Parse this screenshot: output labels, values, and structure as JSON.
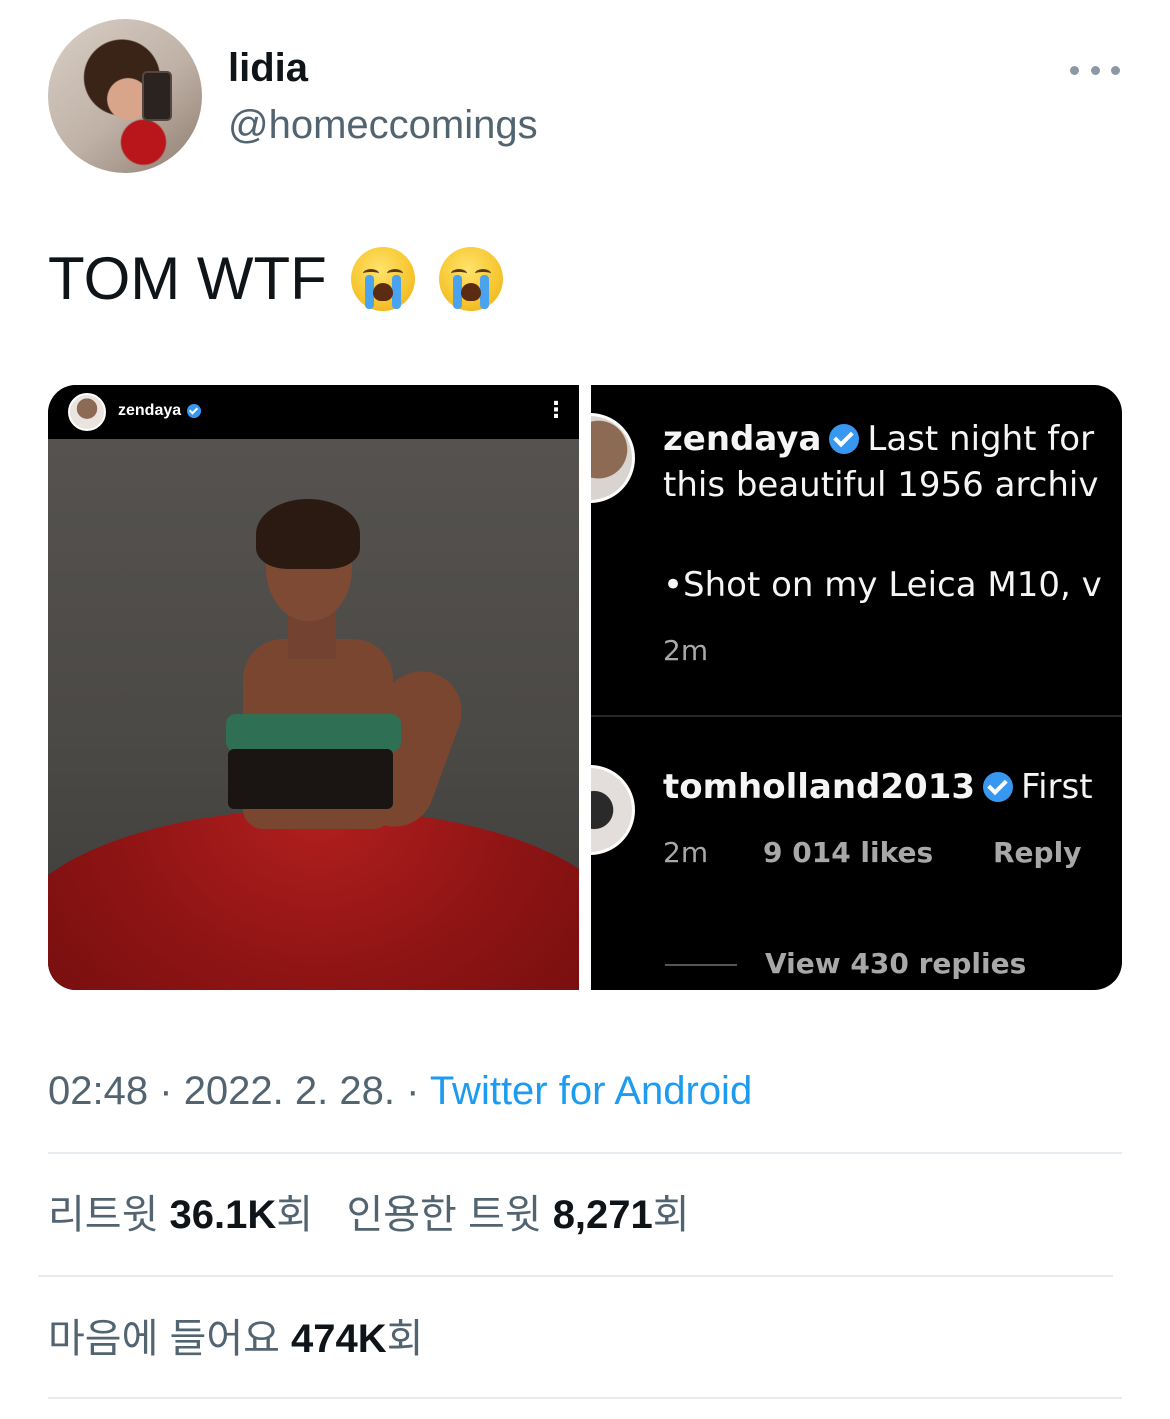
{
  "author": {
    "display_name": "lidia",
    "handle": "@homeccomings"
  },
  "tweet": {
    "text": "TOM WTF",
    "emojis": [
      "loudly-crying-face",
      "loudly-crying-face"
    ]
  },
  "media": {
    "left_image": {
      "ig_username": "zendaya",
      "menu_glyph": "⋮"
    },
    "right_image": {
      "comment1": {
        "username": "zendaya",
        "line1": "Last night for",
        "line2": "this beautiful 1956 archiv",
        "line3": "•Shot on my Leica M10, v",
        "time": "2m"
      },
      "comment2": {
        "username": "tomholland2013",
        "text": "First",
        "time": "2m",
        "likes": "9 014 likes",
        "reply": "Reply",
        "view_replies": "View 430 replies"
      }
    }
  },
  "meta": {
    "time": "02:48",
    "separator": "·",
    "date": "2022. 2. 28.",
    "source": "Twitter for Android"
  },
  "stats": {
    "retweets_label": "리트윗",
    "retweets_count": "36.1K",
    "retweets_suffix": "회",
    "quotes_label": "인용한 트윗",
    "quotes_count": "8,271",
    "quotes_suffix": "회",
    "likes_label": "마음에 들어요",
    "likes_count": "474K",
    "likes_suffix": "회"
  },
  "colors": {
    "link": "#1d9bf0",
    "secondary_text": "#536471",
    "verified": "#3897f0"
  }
}
